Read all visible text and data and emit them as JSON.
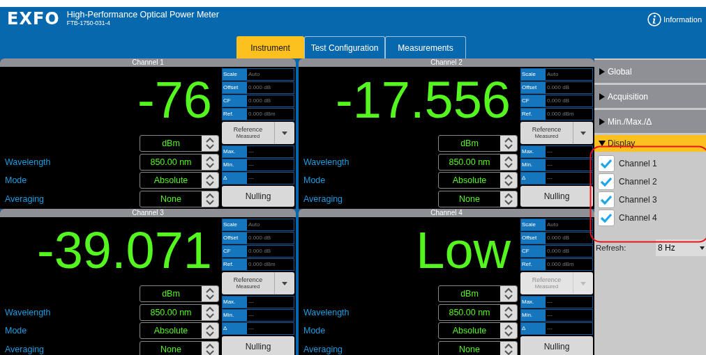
{
  "header": {
    "logo": "EXFO",
    "title": "High-Performance Optical Power Meter",
    "subtitle": "FTB-1750-031-4",
    "info_button": "Information"
  },
  "tabs": [
    {
      "label": "Instrument",
      "selected": true
    },
    {
      "label": "Test Configuration",
      "selected": false
    },
    {
      "label": "Measurements",
      "selected": false
    }
  ],
  "channels": [
    {
      "title": "Channel 1",
      "reading": "-76",
      "unit": "dBm",
      "settings": [
        {
          "label": "Wavelength",
          "value": "850.00 nm"
        },
        {
          "label": "Mode",
          "value": "Absolute"
        },
        {
          "label": "Averaging",
          "value": "None"
        }
      ],
      "info": [
        {
          "label": "Scale",
          "value": "Auto"
        },
        {
          "label": "Offset",
          "value": "0.000 dB"
        },
        {
          "label": "CF",
          "value": "0.000 dB"
        },
        {
          "label": "Ref.",
          "value": "0.000 dBm"
        }
      ],
      "reference": {
        "label": "Reference",
        "sublabel": "Measured",
        "disabled": false
      },
      "stats": [
        {
          "label": "Max.",
          "value": "---"
        },
        {
          "label": "Min.",
          "value": "---"
        },
        {
          "label": "Δ",
          "value": "---"
        }
      ],
      "nulling": "Nulling"
    },
    {
      "title": "Channel 2",
      "reading": "-17.556",
      "unit": "dBm",
      "settings": [
        {
          "label": "Wavelength",
          "value": "850.00 nm"
        },
        {
          "label": "Mode",
          "value": "Absolute"
        },
        {
          "label": "Averaging",
          "value": "None"
        }
      ],
      "info": [
        {
          "label": "Scale",
          "value": "Auto"
        },
        {
          "label": "Offset",
          "value": "0.000 dB"
        },
        {
          "label": "CF",
          "value": "0.000 dB"
        },
        {
          "label": "Ref.",
          "value": "0.000 dBm"
        }
      ],
      "reference": {
        "label": "Reference",
        "sublabel": "Measured",
        "disabled": false
      },
      "stats": [
        {
          "label": "Max.",
          "value": "---"
        },
        {
          "label": "Min.",
          "value": "---"
        },
        {
          "label": "Δ",
          "value": "---"
        }
      ],
      "nulling": "Nulling"
    },
    {
      "title": "Channel 3",
      "reading": "-39.071",
      "unit": "dBm",
      "settings": [
        {
          "label": "Wavelength",
          "value": "850.00 nm"
        },
        {
          "label": "Mode",
          "value": "Absolute"
        },
        {
          "label": "Averaging",
          "value": "None"
        }
      ],
      "info": [
        {
          "label": "Scale",
          "value": "Auto"
        },
        {
          "label": "Offset",
          "value": "0.000 dB"
        },
        {
          "label": "CF",
          "value": "0.000 dB"
        },
        {
          "label": "Ref.",
          "value": "0.000 dBm"
        }
      ],
      "reference": {
        "label": "Reference",
        "sublabel": "Measured",
        "disabled": false
      },
      "stats": [
        {
          "label": "Max.",
          "value": "---"
        },
        {
          "label": "Min.",
          "value": "---"
        },
        {
          "label": "Δ",
          "value": "---"
        }
      ],
      "nulling": "Nulling"
    },
    {
      "title": "Channel 4",
      "reading": "Low",
      "unit": "dBm",
      "settings": [
        {
          "label": "Wavelength",
          "value": "850.00 nm"
        },
        {
          "label": "Mode",
          "value": "Absolute"
        },
        {
          "label": "Averaging",
          "value": "None"
        }
      ],
      "info": [
        {
          "label": "Scale",
          "value": "Auto"
        },
        {
          "label": "Offset",
          "value": "0.000 dB"
        },
        {
          "label": "CF",
          "value": "0.000 dB"
        },
        {
          "label": "Ref.",
          "value": "0.000 dBm"
        }
      ],
      "reference": {
        "label": "Reference",
        "sublabel": "Measured",
        "disabled": true
      },
      "stats": [
        {
          "label": "Max.",
          "value": "---"
        },
        {
          "label": "Min.",
          "value": "---"
        },
        {
          "label": "Δ",
          "value": "---"
        }
      ],
      "nulling": "Nulling"
    }
  ],
  "sidebar": {
    "sections": [
      {
        "label": "Global",
        "expanded": false
      },
      {
        "label": "Acquisition",
        "expanded": false
      },
      {
        "label": "Min./Max./Δ",
        "expanded": false
      },
      {
        "label": "Display",
        "expanded": true
      }
    ],
    "display_channels": [
      {
        "label": "Channel 1",
        "checked": true
      },
      {
        "label": "Channel 2",
        "checked": true
      },
      {
        "label": "Channel 3",
        "checked": true
      },
      {
        "label": "Channel 4",
        "checked": true
      }
    ],
    "refresh": {
      "label": "Refresh:",
      "value": "8 Hz"
    }
  }
}
